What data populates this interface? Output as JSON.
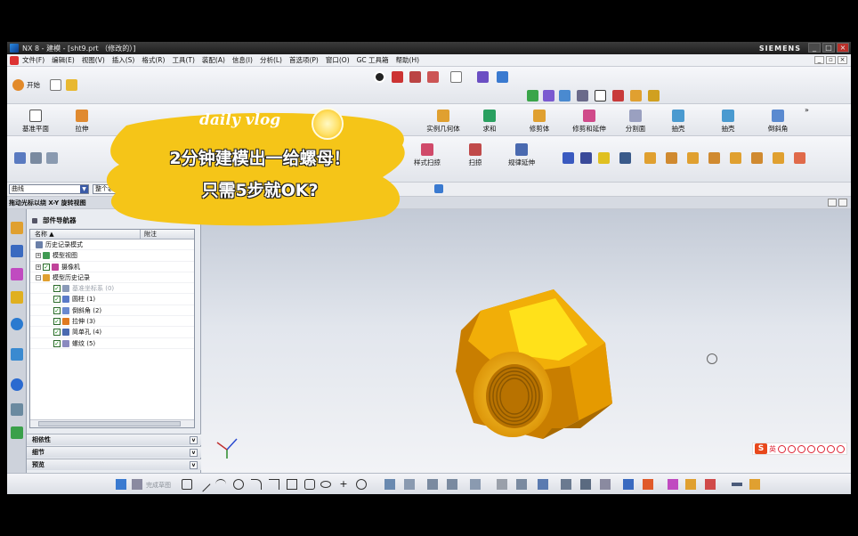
{
  "window": {
    "title": "NX 8 - 建模 - [sht9.prt  （修改的）]",
    "brand": "SIEMENS",
    "controls": [
      "_",
      "□",
      "×"
    ]
  },
  "menu": {
    "items": [
      "文件(F)",
      "编辑(E)",
      "视图(V)",
      "插入(S)",
      "格式(R)",
      "工具(T)",
      "装配(A)",
      "信息(I)",
      "分析(L)",
      "首选项(P)",
      "窗口(O)",
      "GC 工具箱",
      "帮助(H)"
    ]
  },
  "toolbar_top": {
    "start_label": "开始"
  },
  "feature_toolbar": {
    "buttons": [
      "基准平面",
      "拉伸",
      "实例几何体",
      "求和",
      "修剪体",
      "修剪和延伸",
      "分割面",
      "抽壳",
      "抽壳",
      "倒斜角"
    ]
  },
  "surface_toolbar": {
    "buttons": [
      "样式扫掠",
      "扫掠",
      "规律延伸"
    ]
  },
  "selection_bar": {
    "filter_value": "曲线",
    "scope_value": "整个装配"
  },
  "view_status": "拖动光标以绕 X-Y 旋转视图",
  "navigator": {
    "title": "部件导航器",
    "columns": [
      "名称",
      "附注"
    ],
    "rows": [
      {
        "label": "历史记录模式",
        "level": 0,
        "icon_color": "#6a7fa8",
        "checked": false,
        "toggle": ""
      },
      {
        "label": "模型视图",
        "level": 0,
        "icon_color": "#3f9a52",
        "checked": false,
        "toggle": "+"
      },
      {
        "label": "摄像机",
        "level": 0,
        "icon_color": "#c0439a",
        "checked": true,
        "toggle": "+"
      },
      {
        "label": "模型历史记录",
        "level": 0,
        "icon_color": "#e0a030",
        "checked": false,
        "toggle": "−"
      },
      {
        "label": "基准坐标系 (0)",
        "level": 1,
        "icon_color": "#8a9ab8",
        "checked": true,
        "toggle": "",
        "dim": true
      },
      {
        "label": "圆柱 (1)",
        "level": 1,
        "icon_color": "#5a7ac8",
        "checked": true,
        "toggle": ""
      },
      {
        "label": "倒斜角 (2)",
        "level": 1,
        "icon_color": "#6a8ad0",
        "checked": true,
        "toggle": ""
      },
      {
        "label": "拉伸 (3)",
        "level": 1,
        "icon_color": "#e07a20",
        "checked": true,
        "toggle": ""
      },
      {
        "label": "简单孔 (4)",
        "level": 1,
        "icon_color": "#4a6ab0",
        "checked": true,
        "toggle": ""
      },
      {
        "label": "螺纹 (5)",
        "level": 1,
        "icon_color": "#8a8ac0",
        "checked": true,
        "toggle": ""
      }
    ],
    "sections": [
      "相依性",
      "细节",
      "预览"
    ]
  },
  "sketch_toolbar": {
    "label": "完成草图"
  },
  "ime": {
    "lang": "英"
  },
  "overlay": {
    "tag": "daily vlog",
    "line1": "2分钟建模出一给螺母！",
    "line2": "只需5步就OK?",
    "brush_color": "#f5c518"
  }
}
